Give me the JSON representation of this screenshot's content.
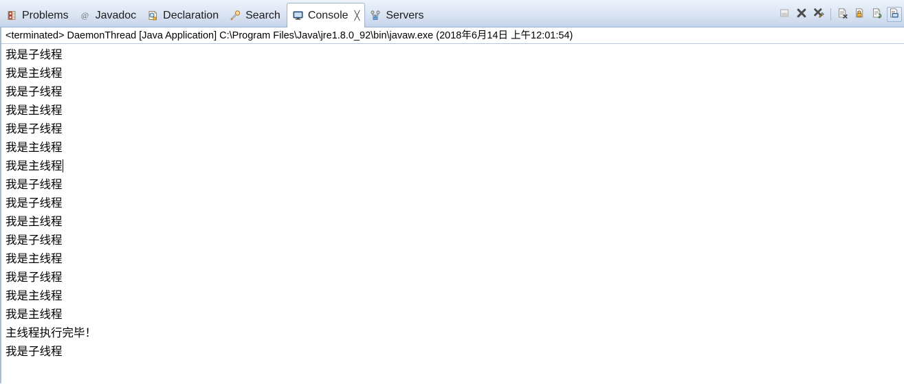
{
  "window": {
    "title": "Console",
    "view_kind": "eclipse-console-view"
  },
  "tabbar": {
    "tabs": [
      {
        "label": "Problems",
        "icon": "problems-icon",
        "active": false,
        "closable": false
      },
      {
        "label": "Javadoc",
        "icon": "javadoc-icon",
        "active": false,
        "closable": false
      },
      {
        "label": "Declaration",
        "icon": "declaration-icon",
        "active": false,
        "closable": false
      },
      {
        "label": "Search",
        "icon": "search-icon",
        "active": false,
        "closable": false
      },
      {
        "label": "Console",
        "icon": "console-icon",
        "active": true,
        "closable": true,
        "close_glyph": "╳"
      },
      {
        "label": "Servers",
        "icon": "servers-icon",
        "active": false,
        "closable": false
      }
    ]
  },
  "toolbar": {
    "buttons": [
      {
        "name": "clear-console-button",
        "icon": "clear-console-icon",
        "enabled": false,
        "pressed": false
      },
      {
        "name": "terminate-button",
        "icon": "terminate-x-icon",
        "enabled": true,
        "pressed": false
      },
      {
        "name": "remove-all-terminated-button",
        "icon": "remove-terminated-icon",
        "enabled": true,
        "pressed": false
      },
      {
        "name": "separator-1",
        "icon": "separator",
        "enabled": false,
        "pressed": false
      },
      {
        "name": "remove-launch-button",
        "icon": "remove-launch-icon",
        "enabled": true,
        "pressed": false
      },
      {
        "name": "scroll-lock-button",
        "icon": "scroll-lock-icon",
        "enabled": true,
        "pressed": false
      },
      {
        "name": "word-wrap-button",
        "icon": "word-wrap-icon",
        "enabled": true,
        "pressed": false
      },
      {
        "name": "display-selected-console-button",
        "icon": "display-console-icon",
        "enabled": true,
        "pressed": true
      }
    ]
  },
  "console": {
    "process_line": "<terminated> DaemonThread [Java Application] C:\\Program Files\\Java\\jre1.8.0_92\\bin\\javaw.exe (2018年6月14日 上午12:01:54)",
    "caret_line_index": 6,
    "output_lines": [
      "我是子线程",
      "我是主线程",
      "我是子线程",
      "我是主线程",
      "我是子线程",
      "我是主线程",
      "我是主线程",
      "我是子线程",
      "我是子线程",
      "我是主线程",
      "我是子线程",
      "我是主线程",
      "我是子线程",
      "我是主线程",
      "我是主线程",
      "主线程执行完毕！",
      "我是子线程"
    ]
  },
  "colors": {
    "tab_bar_top": "#eef3fa",
    "tab_bar_bottom": "#c3d3e8",
    "tab_border": "#9db3ce",
    "active_tab_bg": "#ffffff",
    "console_bg": "#ffffff",
    "text": "#000000",
    "left_border": "#a9bcd4"
  }
}
